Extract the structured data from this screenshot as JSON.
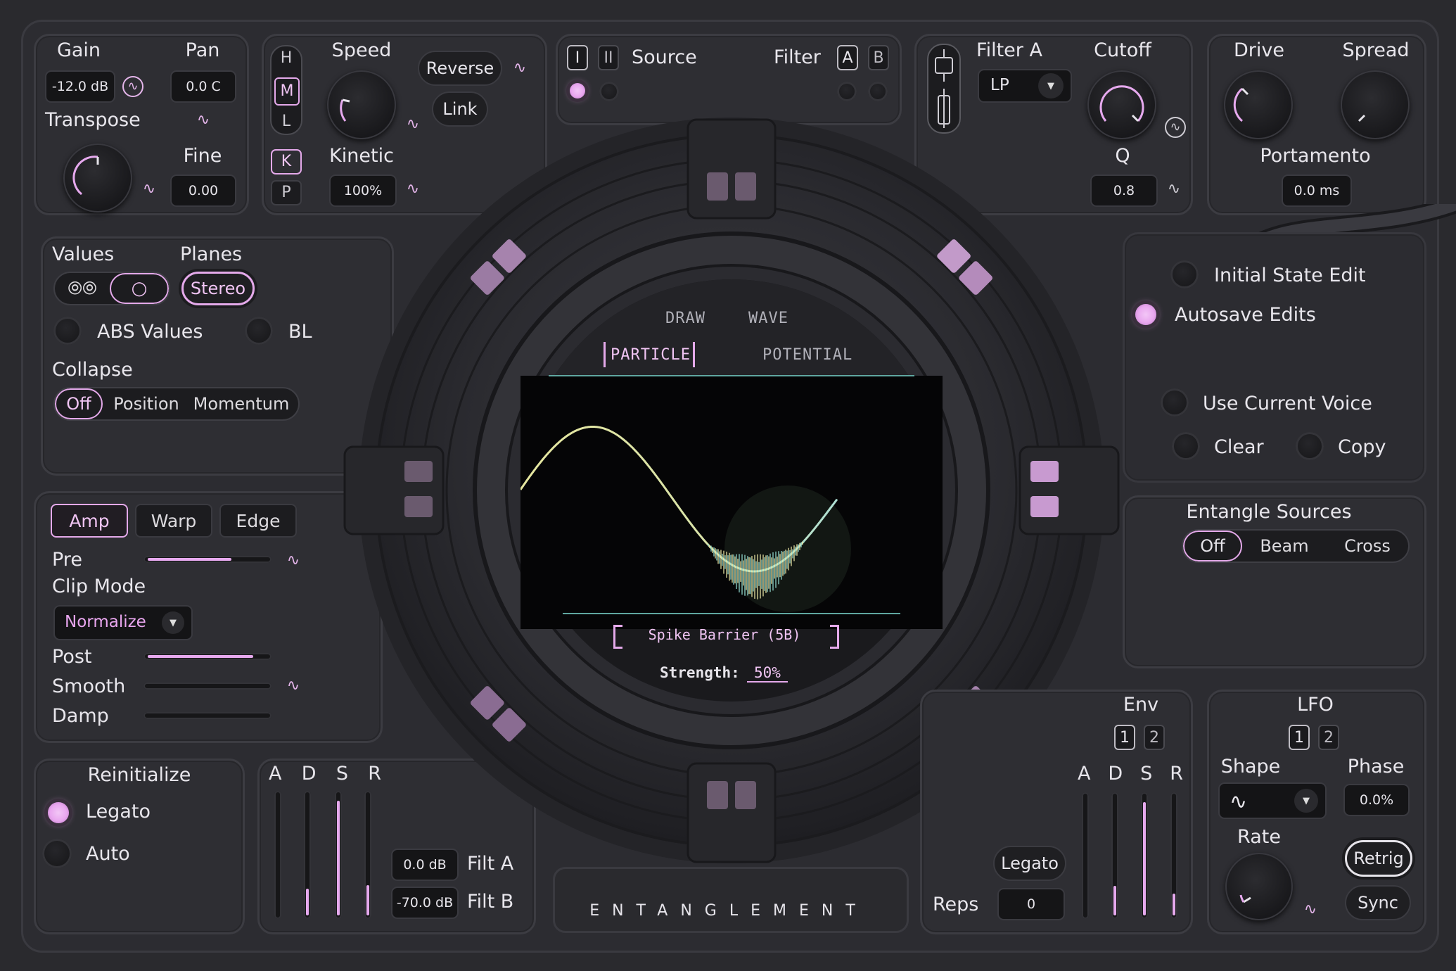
{
  "accent": "#e6a9ee",
  "top_left": {
    "gain_label": "Gain",
    "gain_value": "-12.0 dB",
    "pan_label": "Pan",
    "pan_value": "0.0 C",
    "transpose_label": "Transpose",
    "fine_label": "Fine",
    "fine_value": "0.00"
  },
  "speed": {
    "hml": [
      "H",
      "M",
      "L"
    ],
    "hml_selected": "M",
    "kp": [
      "K",
      "P"
    ],
    "kp_selected": "K",
    "speed_label": "Speed",
    "reverse_label": "Reverse",
    "link_label": "Link",
    "kinetic_label": "Kinetic",
    "kinetic_value": "100%"
  },
  "source": {
    "buttons": [
      "I",
      "II"
    ],
    "source_label": "Source",
    "filter_label": "Filter",
    "filter_buttons": [
      "A",
      "B"
    ]
  },
  "filter_a": {
    "title": "Filter A",
    "type_value": "LP",
    "cutoff_label": "Cutoff",
    "q_label": "Q",
    "q_value": "0.8"
  },
  "drive": {
    "drive_label": "Drive",
    "spread_label": "Spread",
    "portamento_label": "Portamento",
    "portamento_value": "0.0 ms"
  },
  "values_panel": {
    "values_label": "Values",
    "planes_label": "Planes",
    "planes_value": "Stereo",
    "abs_label": "ABS Values",
    "bl_label": "BL",
    "collapse_label": "Collapse",
    "collapse_options": [
      "Off",
      "Position",
      "Momentum"
    ],
    "collapse_selected": "Off"
  },
  "amp_panel": {
    "tabs": [
      "Amp",
      "Warp",
      "Edge"
    ],
    "tab_selected": "Amp",
    "pre_label": "Pre",
    "pre_level": 0.7,
    "clip_mode_label": "Clip Mode",
    "clip_mode_value": "Normalize",
    "post_label": "Post",
    "post_level": 0.88,
    "smooth_label": "Smooth",
    "smooth_level": 0.0,
    "damp_label": "Damp",
    "damp_level": 0.0
  },
  "reinit": {
    "title": "Reinitialize",
    "options": [
      "Legato",
      "Auto"
    ],
    "selected": "Legato"
  },
  "adsr_left": {
    "labels": [
      "A",
      "D",
      "S",
      "R"
    ],
    "levels": [
      0.0,
      0.22,
      0.95,
      0.25
    ],
    "filt_a_value": "0.0 dB",
    "filt_a_label": "Filt A",
    "filt_b_value": "-70.0 dB",
    "filt_b_label": "Filt B"
  },
  "center": {
    "tabs": [
      "DRAW",
      "WAVE",
      "PARTICLE",
      "POTENTIAL"
    ],
    "tab_selected": "PARTICLE",
    "preset_name": "Spike Barrier (5B)",
    "strength_label": "Strength:",
    "strength_value": "50%",
    "brand": "ENTANGLEMENT"
  },
  "right_options": {
    "initial_state_edit": "Initial State Edit",
    "autosave_edits": "Autosave Edits",
    "use_current_voice": "Use Current Voice",
    "clear": "Clear",
    "copy": "Copy"
  },
  "entangle": {
    "title": "Entangle Sources",
    "options": [
      "Off",
      "Beam",
      "Cross"
    ],
    "selected": "Off"
  },
  "env": {
    "title": "Env",
    "buttons": [
      "1",
      "2"
    ],
    "legato_label": "Legato",
    "reps_label": "Reps",
    "reps_value": "0",
    "labels": [
      "A",
      "D",
      "S",
      "R"
    ],
    "levels": [
      0.0,
      0.25,
      0.95,
      0.18
    ]
  },
  "lfo": {
    "title": "LFO",
    "buttons": [
      "1",
      "2"
    ],
    "shape_label": "Shape",
    "phase_label": "Phase",
    "phase_value": "0.0%",
    "rate_label": "Rate",
    "retrig_label": "Retrig",
    "sync_label": "Sync"
  }
}
